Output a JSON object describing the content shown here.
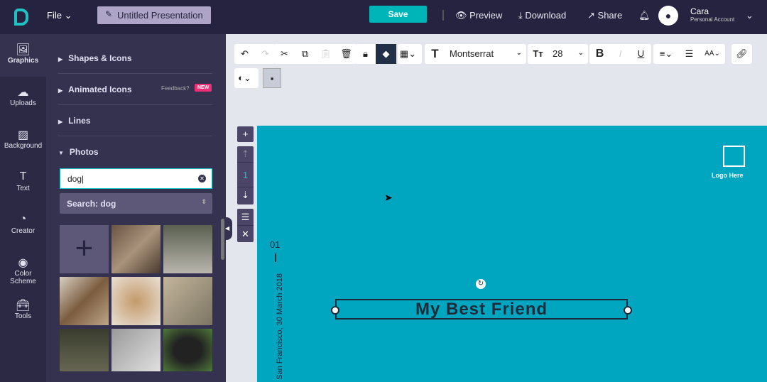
{
  "header": {
    "file": "File",
    "title": "Untitled Presentation",
    "save": "Save",
    "preview": "Preview",
    "download": "Download",
    "share": "Share",
    "user_name": "Cara",
    "user_account": "Personal Account"
  },
  "rail": [
    {
      "label": "Graphics"
    },
    {
      "label": "Uploads"
    },
    {
      "label": "Background"
    },
    {
      "label": "Text"
    },
    {
      "label": "Creator"
    },
    {
      "label": "Color Scheme"
    },
    {
      "label": "Tools"
    }
  ],
  "panel": {
    "sections": [
      "Shapes & Icons",
      "Animated Icons",
      "Lines",
      "Photos"
    ],
    "feedback": "Feedback?",
    "new_badge": "NEW",
    "search_value": "dog",
    "search_select": "Search: dog"
  },
  "toolbar": {
    "font": "Montserrat",
    "size": "28"
  },
  "pages": {
    "current": "1"
  },
  "canvas": {
    "logo": "Logo Here",
    "number": "01",
    "vertical_text": "San Francisco, 30 March 2018",
    "title": "My Best Friend",
    "bg": "#00a5c0"
  }
}
